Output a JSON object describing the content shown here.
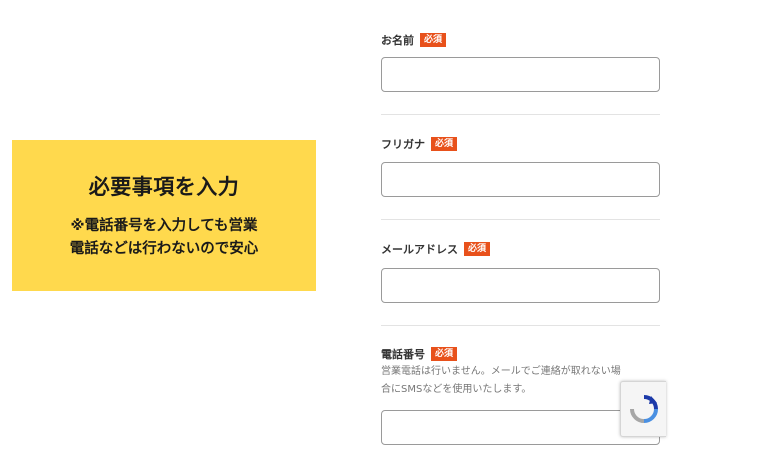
{
  "callout": {
    "title": "必要事項を入力",
    "note_line1": "※電話番号を入力しても営業",
    "note_line2": "電話などは行わないので安心"
  },
  "form": {
    "required_badge": "必須",
    "fields": [
      {
        "label": "お名前",
        "value": ""
      },
      {
        "label": "フリガナ",
        "value": ""
      },
      {
        "label": "メールアドレス",
        "value": ""
      },
      {
        "label": "電話番号",
        "help_line1": "営業電話は行いません。メールでご連絡が取れない場",
        "help_line2": "合にSMSなどを使用いたします。",
        "value": ""
      }
    ]
  },
  "colors": {
    "callout_bg": "#ffd94d",
    "badge_bg": "#e8511b",
    "border": "#9a9a9a"
  },
  "icons": {
    "recaptcha": "recaptcha-icon"
  }
}
